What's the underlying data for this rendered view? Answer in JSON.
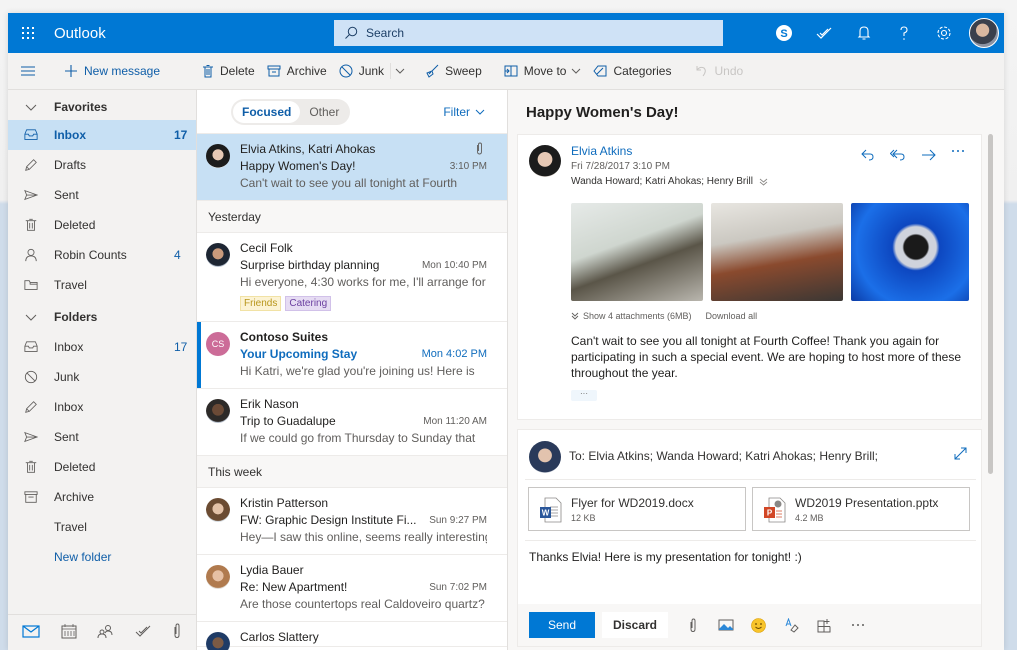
{
  "app": {
    "title": "Outlook"
  },
  "header": {
    "search_placeholder": "Search",
    "icons": [
      "skype-icon",
      "todo-icon",
      "bell-icon",
      "help-icon",
      "gear-icon",
      "avatar"
    ]
  },
  "command_bar": {
    "new_message": "New message",
    "delete": "Delete",
    "archive": "Archive",
    "junk": "Junk",
    "sweep": "Sweep",
    "move_to": "Move to",
    "categories": "Categories",
    "undo": "Undo"
  },
  "nav": {
    "favorites_label": "Favorites",
    "favorites": [
      {
        "label": "Inbox",
        "count": "17",
        "icon": "inbox-icon",
        "selected": true
      },
      {
        "label": "Drafts",
        "count": "",
        "icon": "pencil-icon"
      },
      {
        "label": "Sent",
        "count": "",
        "icon": "send-icon"
      },
      {
        "label": "Deleted",
        "count": "",
        "icon": "trash-icon"
      },
      {
        "label": "Robin Counts",
        "count": "4",
        "icon": "person-icon"
      },
      {
        "label": "Travel",
        "count": "",
        "icon": "folder-icon"
      }
    ],
    "folders_label": "Folders",
    "folders": [
      {
        "label": "Inbox",
        "count": "17",
        "icon": "inbox-icon"
      },
      {
        "label": "Junk",
        "count": "",
        "icon": "block-icon"
      },
      {
        "label": "Inbox",
        "count": "",
        "icon": "pencil-icon"
      },
      {
        "label": "Sent",
        "count": "",
        "icon": "send-icon"
      },
      {
        "label": "Deleted",
        "count": "",
        "icon": "trash-icon"
      },
      {
        "label": "Archive",
        "count": "",
        "icon": "archive-icon"
      },
      {
        "label": "Travel",
        "count": "",
        "icon": ""
      }
    ],
    "new_folder": "New folder",
    "bottom_icons": [
      "mail-icon",
      "calendar-icon",
      "people-icon",
      "todo-icon",
      "paperclip-icon"
    ]
  },
  "list": {
    "pivot": {
      "focused": "Focused",
      "other": "Other"
    },
    "filter": "Filter",
    "groups": {
      "yesterday": "Yesterday",
      "this_week": "This week"
    },
    "messages": [
      {
        "from": "Elvia Atkins, Katri Ahokas",
        "subject": "Happy Women's Day!",
        "time": "3:10 PM",
        "preview": "Can't wait to see you all tonight at Fourth",
        "has_attachment": true,
        "selected": true
      },
      {
        "from": "Cecil Folk",
        "subject": "Surprise birthday planning",
        "time": "Mon 10:40 PM",
        "preview": "Hi everyone, 4:30 works for me, I'll arrange for",
        "tags": [
          "Friends",
          "Catering"
        ]
      },
      {
        "from": "Contoso Suites",
        "subject": "Your Upcoming Stay",
        "time": "Mon 4:02 PM",
        "preview": "Hi Katri, we're glad you're joining us! Here is",
        "unread": true,
        "initials": "CS"
      },
      {
        "from": "Erik Nason",
        "subject": "Trip to Guadalupe",
        "time": "Mon 11:20 AM",
        "preview": "If we could go from Thursday to Sunday that"
      },
      {
        "from": "Kristin Patterson",
        "subject": "FW: Graphic Design Institute Fi...",
        "time": "Sun 9:27 PM",
        "preview": "Hey—I saw this online, seems really interesting."
      },
      {
        "from": "Lydia Bauer",
        "subject": "Re: New Apartment!",
        "time": "Sun 7:02 PM",
        "preview": "Are those countertops real Caldoveiro quartz?"
      },
      {
        "from": "Carlos Slattery",
        "subject": "",
        "time": "",
        "preview": ""
      }
    ]
  },
  "reading": {
    "subject": "Happy Women's Day!",
    "message": {
      "sender": "Elvia Atkins",
      "date": "Fri 7/28/2017 3:10 PM",
      "recipients": "Wanda Howard; Katri Ahokas; Henry Brill",
      "attachments_summary": "Show 4 attachments (6MB)",
      "download_all": "Download all",
      "body": "Can't wait to see you all tonight at Fourth Coffee! Thank you again for participating in such a special event. We are hoping to host more of these throughout the year.",
      "more": "···"
    },
    "reply": {
      "to": "To: Elvia Atkins; Wanda Howard; Katri Ahokas; Henry Brill;",
      "files": [
        {
          "name": "Flyer for WD2019.docx",
          "size": "12 KB",
          "type": "word"
        },
        {
          "name": "WD2019 Presentation.pptx",
          "size": "4.2 MB",
          "type": "powerpoint"
        }
      ],
      "body": "Thanks Elvia! Here is my presentation for tonight! :)",
      "send": "Send",
      "discard": "Discard",
      "more": "···"
    }
  },
  "colors": {
    "brand": "#0078d4",
    "selected": "#c7e0f4",
    "link": "#0f6cbd"
  }
}
